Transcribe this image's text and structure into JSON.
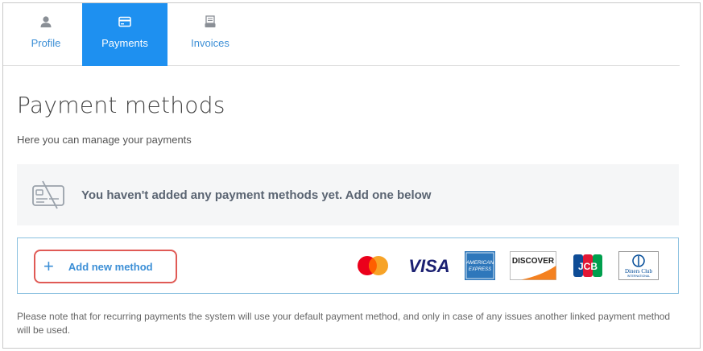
{
  "tabs": [
    {
      "label": "Profile",
      "icon": "user-icon",
      "active": false
    },
    {
      "label": "Payments",
      "icon": "card-icon",
      "active": true
    },
    {
      "label": "Invoices",
      "icon": "invoice-icon",
      "active": false
    }
  ],
  "page": {
    "title": "Payment methods",
    "subtitle": "Here you can manage your payments"
  },
  "empty_state": {
    "icon": "card-disabled-icon",
    "message": "You haven't added any payment methods yet. Add one below"
  },
  "add_method": {
    "plus": "+",
    "label": "Add new method"
  },
  "card_brands": {
    "visa": "VISA",
    "amex_line1": "AMERICAN",
    "amex_line2": "EXPRESS",
    "discover": "DISCOVER",
    "jcb": "JCB",
    "diners_line1": "Diners Club",
    "diners_line2": "INTERNATIONAL"
  },
  "note": "Please note that for recurring payments the system will use your default payment method, and only in case of any issues another linked payment method will be used.",
  "colors": {
    "accent": "#1e90f0",
    "link": "#3c8fd6",
    "highlight": "#e05a55",
    "border": "#8ac0e0"
  }
}
